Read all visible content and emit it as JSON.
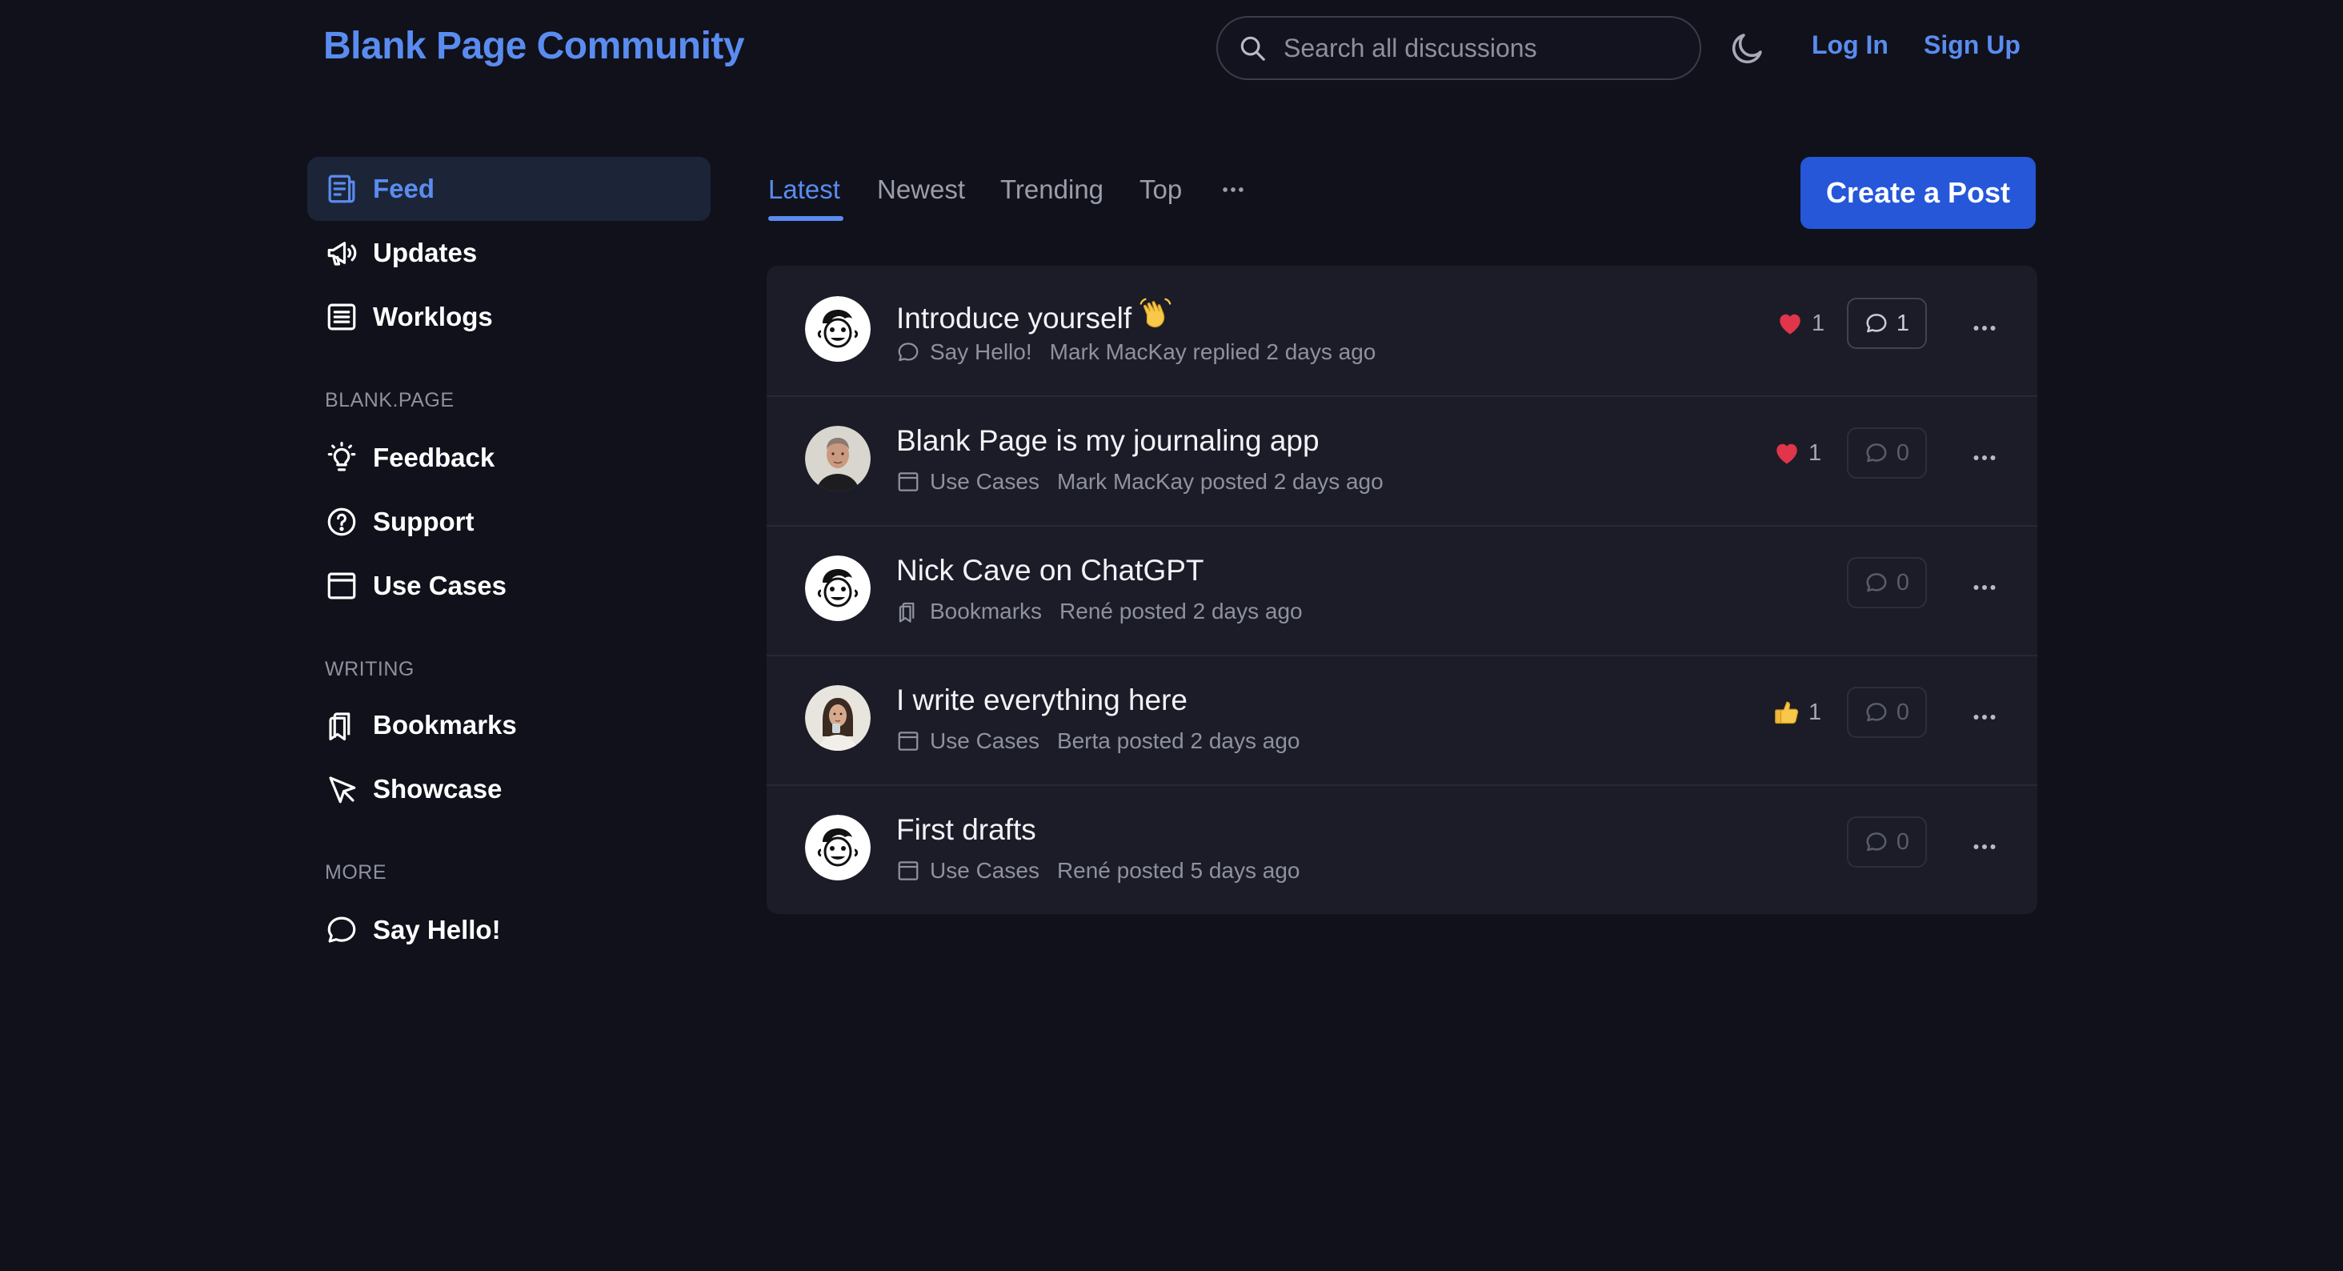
{
  "header": {
    "brand": "Blank Page Community",
    "search_placeholder": "Search all discussions",
    "login": "Log In",
    "signup": "Sign Up"
  },
  "sidebar": {
    "items": [
      {
        "label": "Feed",
        "icon": "feed-icon",
        "active": true
      },
      {
        "label": "Updates",
        "icon": "megaphone-icon"
      },
      {
        "label": "Worklogs",
        "icon": "list-icon"
      }
    ],
    "sections": [
      {
        "title": "BLANK.PAGE",
        "items": [
          {
            "label": "Feedback",
            "icon": "lightbulb-icon"
          },
          {
            "label": "Support",
            "icon": "question-circle-icon"
          },
          {
            "label": "Use Cases",
            "icon": "calendar-icon"
          }
        ]
      },
      {
        "title": "WRITING",
        "items": [
          {
            "label": "Bookmarks",
            "icon": "bookmark-icon"
          },
          {
            "label": "Showcase",
            "icon": "cursor-icon"
          }
        ]
      },
      {
        "title": "MORE",
        "items": [
          {
            "label": "Say Hello!",
            "icon": "chat-bubble-icon"
          }
        ]
      }
    ]
  },
  "tabs": [
    "Latest",
    "Newest",
    "Trending",
    "Top"
  ],
  "active_tab": "Latest",
  "create_post": "Create a Post",
  "posts": [
    {
      "title": "Introduce yourself",
      "emoji": "waving-hand-icon",
      "category": "Say Hello!",
      "category_icon": "chat-bubble-icon",
      "activity": "Mark MacKay replied 2 days ago",
      "avatar": "cartoon-avatar",
      "reaction": {
        "icon": "heart-icon",
        "count": "1"
      },
      "comments": "1"
    },
    {
      "title": "Blank Page is my journaling app",
      "category": "Use Cases",
      "category_icon": "calendar-icon",
      "activity": "Mark MacKay posted 2 days ago",
      "avatar": "photo-avatar-man",
      "reaction": {
        "icon": "heart-icon",
        "count": "1"
      },
      "comments": "0"
    },
    {
      "title": "Nick Cave on ChatGPT",
      "category": "Bookmarks",
      "category_icon": "bookmark-icon",
      "activity": "René posted 2 days ago",
      "avatar": "cartoon-avatar",
      "comments": "0"
    },
    {
      "title": "I write everything here",
      "category": "Use Cases",
      "category_icon": "calendar-icon",
      "activity": "Berta posted 2 days ago",
      "avatar": "photo-avatar-woman",
      "reaction": {
        "icon": "thumbs-up-icon",
        "count": "1"
      },
      "comments": "0"
    },
    {
      "title": "First drafts",
      "category": "Use Cases",
      "category_icon": "calendar-icon",
      "activity": "René posted 5 days ago",
      "avatar": "cartoon-avatar",
      "comments": "0"
    }
  ],
  "colors": {
    "background": "#10111b",
    "accent": "#5a8cf0",
    "button": "#2557d8",
    "card": "#1b1c27",
    "heart": "#e0354a"
  }
}
